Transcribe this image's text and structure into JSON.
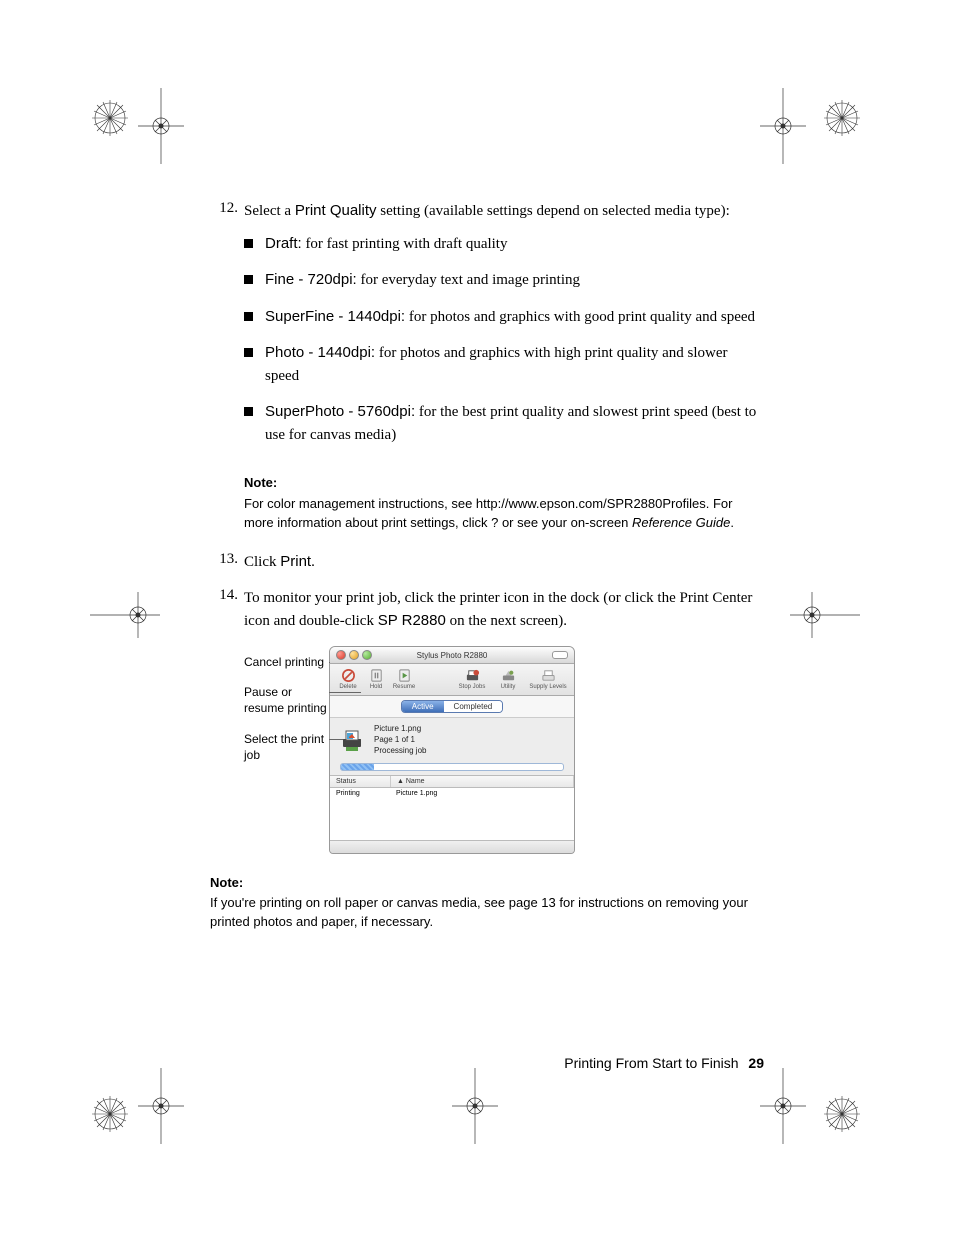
{
  "step12": {
    "num": "12.",
    "intro_before": "Select a ",
    "intro_bold": "Print Quality",
    "intro_after": " setting (available settings depend on selected media type):",
    "bullets": [
      {
        "label": "Draft:",
        "desc": " for fast printing with draft quality"
      },
      {
        "label": "Fine - 720dpi:",
        "desc": " for everyday text and image printing"
      },
      {
        "label": "SuperFine - 1440dpi:",
        "desc": " for photos and graphics with good print quality and speed"
      },
      {
        "label": "Photo - 1440dpi:",
        "desc": " for photos and graphics with high print quality and slower speed"
      },
      {
        "label": "SuperPhoto - 5760dpi:",
        "desc": " for the best print quality and slowest print speed (best to use for canvas media)"
      }
    ]
  },
  "note1": {
    "title": "Note:",
    "body_a": "For color management instructions, see http://www.epson.com/SPR2880Profiles. For more information about print settings, click ",
    "body_q": "?",
    "body_b": " or see your on-screen ",
    "body_italic": "Reference Guide",
    "body_end": "."
  },
  "step13": {
    "num": "13.",
    "before": "Click ",
    "bold": "Print",
    "after": "."
  },
  "step14": {
    "num": "14.",
    "line1": "To monitor your print job, click the printer icon in the dock (or click the Print Center icon and double-click ",
    "bold": "SP R2880",
    "after": " on the next screen)."
  },
  "callouts": {
    "c1": "Cancel printing",
    "c2": "Pause or resume printing",
    "c3": "Select the print job"
  },
  "window": {
    "title": "Stylus Photo R2880",
    "toolbar": {
      "delete": "Delete",
      "hold": "Hold",
      "resume": "Resume",
      "stopjobs": "Stop Jobs",
      "utility": "Utility",
      "supply": "Supply Levels"
    },
    "tabs": {
      "active": "Active",
      "completed": "Completed"
    },
    "job": {
      "file": "Picture 1.png",
      "page": "Page 1 of 1",
      "status_line": "Processing job"
    },
    "headers": {
      "status": "Status",
      "name": "Name"
    },
    "row": {
      "status": "Printing",
      "name": "Picture 1.png"
    }
  },
  "note2": {
    "title": "Note:",
    "body": "If you're printing on roll paper or canvas media, see page 13 for instructions on removing your printed photos and paper, if necessary."
  },
  "footer": {
    "label": "Printing From Start to Finish",
    "page": "29"
  }
}
